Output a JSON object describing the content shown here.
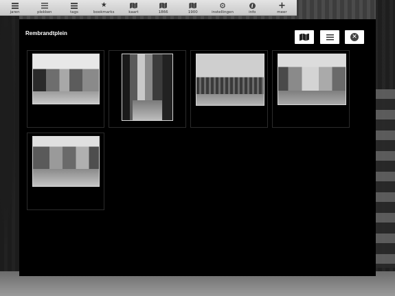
{
  "toolbar": {
    "items": [
      {
        "label": "jaren",
        "icon": "list-icon"
      },
      {
        "label": "plekken",
        "icon": "list-icon"
      },
      {
        "label": "tags",
        "icon": "list-icon"
      },
      {
        "label": "bookmarks",
        "icon": "star-icon"
      },
      {
        "label": "kaart",
        "icon": "map-icon"
      },
      {
        "label": "1866",
        "icon": "map-icon"
      },
      {
        "label": "1900",
        "icon": "map-icon"
      },
      {
        "label": "instellingen",
        "icon": "gear-icon"
      },
      {
        "label": "info",
        "icon": "info-icon"
      },
      {
        "label": "meer",
        "icon": "plus-icon"
      }
    ]
  },
  "modal": {
    "title": "Rembrandtplein",
    "buttons": [
      {
        "name": "map-view",
        "icon": "map-icon"
      },
      {
        "name": "list-view",
        "icon": "list-icon"
      },
      {
        "name": "close",
        "icon": "close-icon"
      }
    ],
    "thumbnails": [
      {
        "id": 1,
        "orientation": "landscape"
      },
      {
        "id": 2,
        "orientation": "portrait"
      },
      {
        "id": 3,
        "orientation": "landscape"
      },
      {
        "id": 4,
        "orientation": "landscape"
      },
      {
        "id": 5,
        "orientation": "landscape"
      }
    ]
  },
  "glyphs": {
    "star": "★",
    "gear": "⚙",
    "info": "i",
    "plus": "+",
    "close": "✕"
  }
}
